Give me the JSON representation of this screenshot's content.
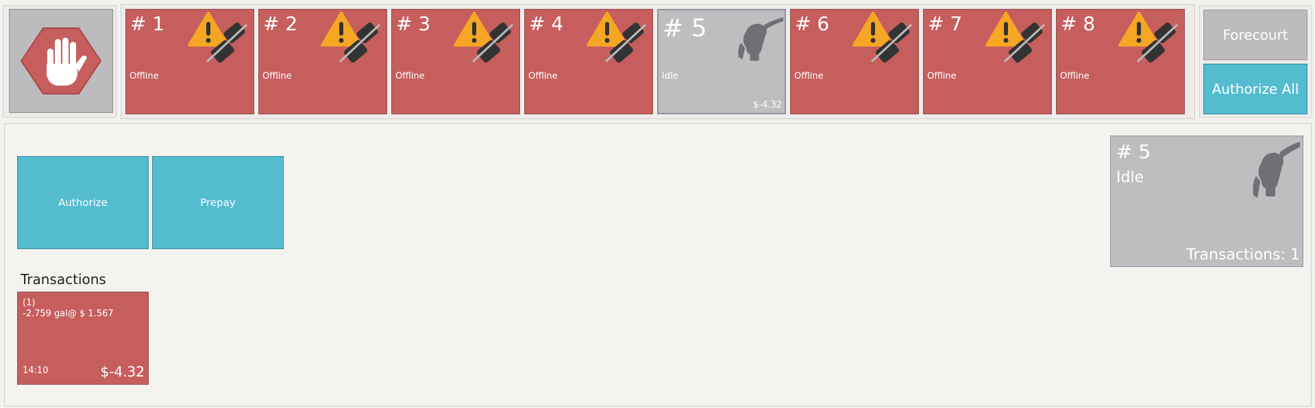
{
  "stop_button": {
    "icon": "hand-stop-icon",
    "color": "#c75e5e"
  },
  "pumps": [
    {
      "number": "# 1",
      "status": "Offline",
      "icon": "offline-warning-plug-icon"
    },
    {
      "number": "# 2",
      "status": "Offline",
      "icon": "offline-warning-plug-icon"
    },
    {
      "number": "# 3",
      "status": "Offline",
      "icon": "offline-warning-plug-icon"
    },
    {
      "number": "# 4",
      "status": "Offline",
      "icon": "offline-warning-plug-icon"
    },
    {
      "number": "# 5",
      "status": "Idle",
      "amount": "$-4.32",
      "icon": "fuel-nozzle-icon"
    },
    {
      "number": "# 6",
      "status": "Offline",
      "icon": "offline-warning-plug-icon"
    },
    {
      "number": "# 7",
      "status": "Offline",
      "icon": "offline-warning-plug-icon"
    },
    {
      "number": "# 8",
      "status": "Offline",
      "icon": "offline-warning-plug-icon"
    }
  ],
  "actions": {
    "forecourt": "Forecourt",
    "authorize_all": "Authorize All"
  },
  "main": {
    "authorize": "Authorize",
    "prepay": "Prepay",
    "transactions_title": "Transactions",
    "transaction": {
      "index": "(1)",
      "detail": "-2.759 gal@ $ 1.567",
      "time": "14:10",
      "amount": "$-4.32"
    }
  },
  "selected_pump": {
    "number": "# 5",
    "status": "Idle",
    "transactions": "Transactions: 1",
    "icon": "fuel-nozzle-icon"
  },
  "colors": {
    "offline": "#c75e5e",
    "idle": "#bdbec0",
    "accent": "#53bccf",
    "warning": "#f5a623"
  }
}
